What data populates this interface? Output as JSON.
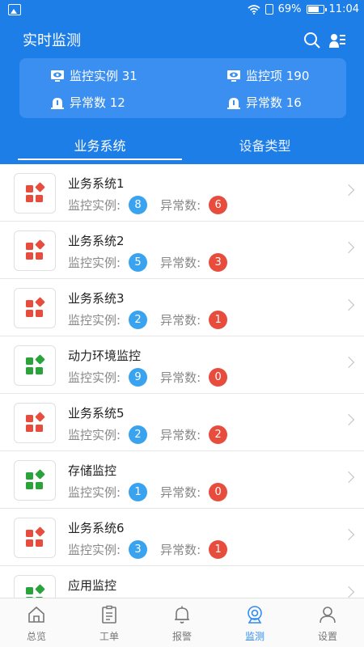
{
  "status_bar": {
    "battery_pct": "69%",
    "time": "11:04"
  },
  "header": {
    "title": "实时监测",
    "stats": {
      "instances": "监控实例 31",
      "items": "监控项 190",
      "abnormal_left": "异常数 12",
      "abnormal_right": "异常数 16"
    },
    "tabs": [
      {
        "label": "业务系统",
        "active": true
      },
      {
        "label": "设备类型",
        "active": false
      }
    ]
  },
  "list": {
    "instance_label": "监控实例:",
    "abnormal_label": "异常数:",
    "rows": [
      {
        "title": "业务系统1",
        "instances": "8",
        "abnormal": "6",
        "icon_color": "#e74c3c"
      },
      {
        "title": "业务系统2",
        "instances": "5",
        "abnormal": "3",
        "icon_color": "#e74c3c"
      },
      {
        "title": "业务系统3",
        "instances": "2",
        "abnormal": "1",
        "icon_color": "#e74c3c"
      },
      {
        "title": "动力环境监控",
        "instances": "9",
        "abnormal": "0",
        "icon_color": "#2aa33a"
      },
      {
        "title": "业务系统5",
        "instances": "2",
        "abnormal": "2",
        "icon_color": "#e74c3c"
      },
      {
        "title": "存储监控",
        "instances": "1",
        "abnormal": "0",
        "icon_color": "#2aa33a"
      },
      {
        "title": "业务系统6",
        "instances": "3",
        "abnormal": "1",
        "icon_color": "#e74c3c"
      },
      {
        "title": "应用监控",
        "instances": "",
        "abnormal": "",
        "icon_color": "#2aa33a"
      }
    ]
  },
  "bottom_nav": [
    {
      "label": "总览",
      "icon": "home-icon",
      "active": false
    },
    {
      "label": "工单",
      "icon": "clipboard-icon",
      "active": false
    },
    {
      "label": "报警",
      "icon": "bell-icon",
      "active": false
    },
    {
      "label": "监测",
      "icon": "monitor-icon",
      "active": true
    },
    {
      "label": "设置",
      "icon": "person-icon",
      "active": false
    }
  ],
  "colors": {
    "primary": "#1e7ee8",
    "badge_blue": "#3aa3ef",
    "badge_red": "#e74c3c",
    "icon_red": "#e74c3c",
    "icon_green": "#2aa33a",
    "active_nav": "#2d8cf0"
  }
}
